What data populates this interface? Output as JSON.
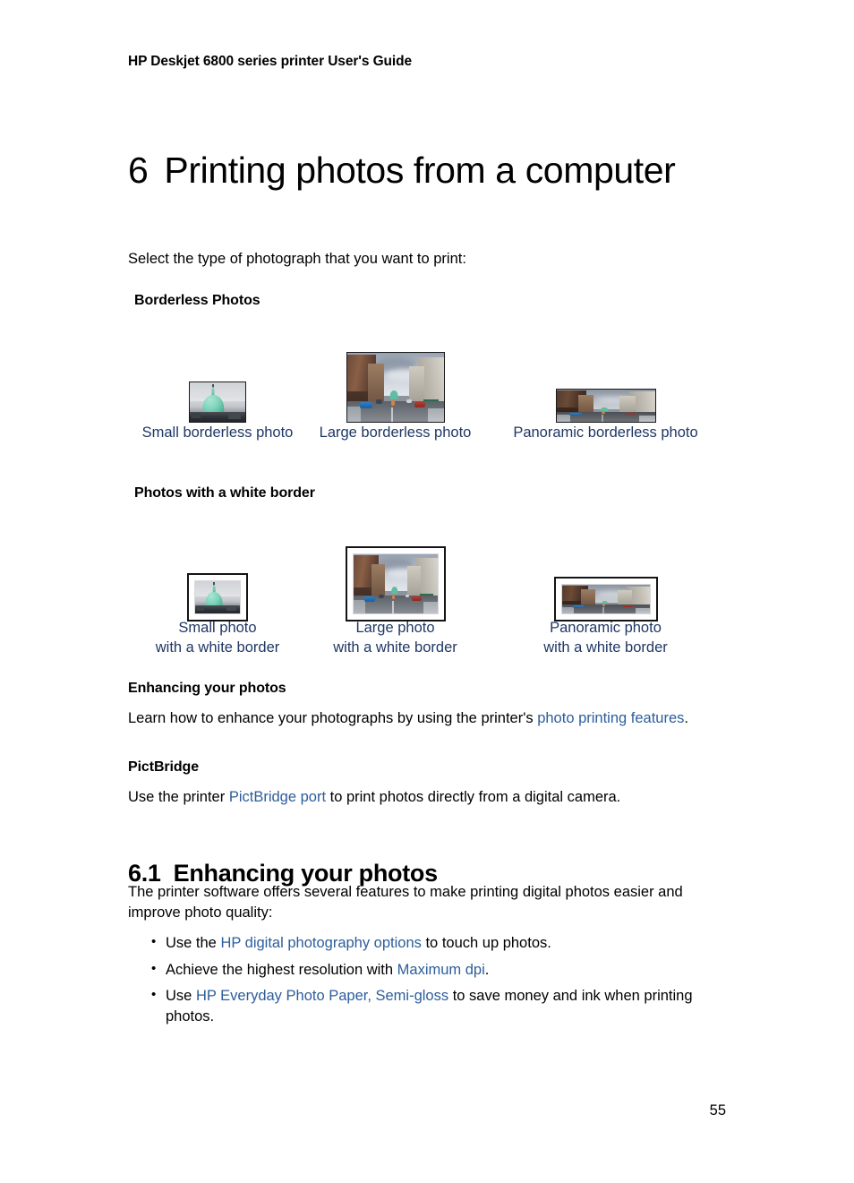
{
  "document": {
    "running_header": "HP Deskjet 6800 series printer User's Guide",
    "page_number": "55"
  },
  "chapter": {
    "number": "6",
    "title": "Printing photos from a computer",
    "intro": "Select the type of photograph that you want to print:"
  },
  "borderless_section": {
    "heading": "Borderless Photos",
    "items": [
      {
        "caption": "Small borderless photo",
        "image_alt": "small photo of a green dome against a cloudy sky"
      },
      {
        "caption": "Large borderless photo",
        "image_alt": "large photo of a city street with cars and buildings"
      },
      {
        "caption": "Panoramic borderless photo",
        "image_alt": "panoramic photo of a city street"
      }
    ]
  },
  "white_border_section": {
    "heading": "Photos with a white border",
    "items": [
      {
        "caption_line1": "Small photo",
        "caption_line2": "with a white border",
        "image_alt": "small framed photo of a green dome"
      },
      {
        "caption_line1": "Large photo",
        "caption_line2": "with a white border",
        "image_alt": "large framed photo of a city street"
      },
      {
        "caption_line1": "Panoramic photo",
        "caption_line2": "with a white border",
        "image_alt": "panoramic framed photo of a city street"
      }
    ]
  },
  "enhancing_block": {
    "heading": "Enhancing your photos",
    "text_before": "Learn how to enhance your photographs by using the printer's ",
    "link": "photo printing features",
    "text_after": "."
  },
  "pictbridge_block": {
    "heading": "PictBridge",
    "text_before": "Use the printer ",
    "link": "PictBridge port",
    "text_after": " to print photos directly from a digital camera."
  },
  "section_61": {
    "number": "6.1",
    "title": "Enhancing your photos",
    "intro": "The printer software offers several features to make printing digital photos easier and improve photo quality:",
    "bullets": [
      {
        "before": "Use the ",
        "link": "HP digital photography options",
        "after": " to touch up photos."
      },
      {
        "before": "Achieve the highest resolution with ",
        "link": "Maximum dpi",
        "after": "."
      },
      {
        "before": "Use ",
        "link": "HP Everyday Photo Paper, Semi-gloss",
        "after": " to save money and ink when printing photos."
      }
    ]
  },
  "colors": {
    "link_blue": "#2c5d9b",
    "caption_blue": "#1f3864",
    "text_black": "#000000",
    "page_background": "#ffffff"
  }
}
